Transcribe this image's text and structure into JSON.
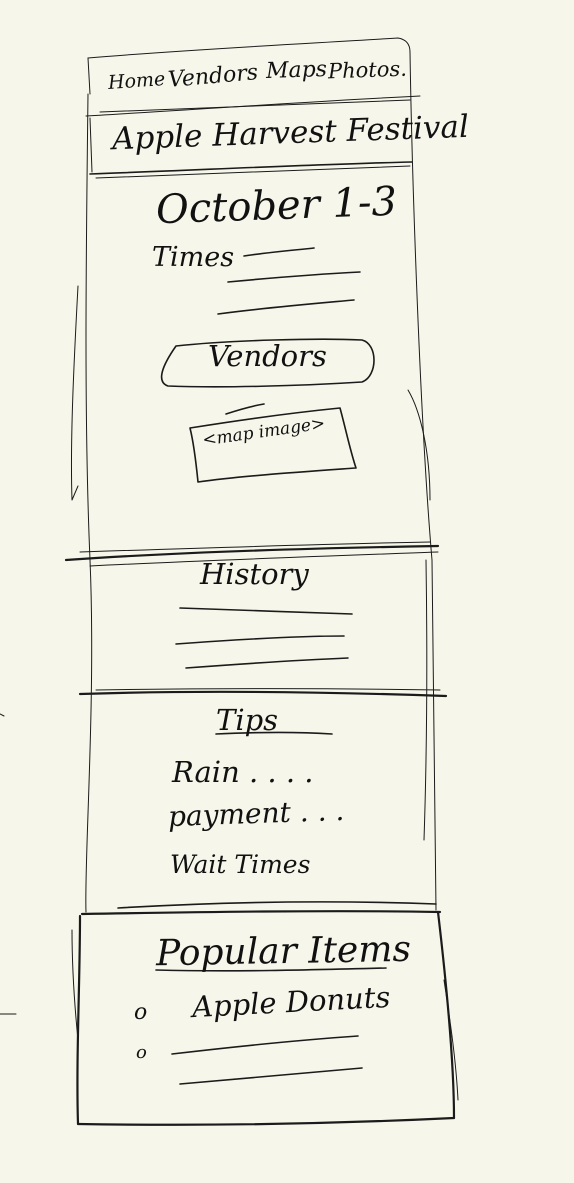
{
  "nav": {
    "home": "Home",
    "vendors": "Vendors",
    "maps": "Maps",
    "photos": "Photos."
  },
  "header": {
    "title": "Apple Harvest Festival"
  },
  "event": {
    "dates": "October 1-3",
    "times_label": "Times"
  },
  "vendors_button": {
    "label": "Vendors"
  },
  "map": {
    "placeholder": "<map image>"
  },
  "history": {
    "heading": "History"
  },
  "tips": {
    "heading": "Tips",
    "items": [
      "Rain . . . .",
      "payment . . .",
      "Wait Times"
    ]
  },
  "popular": {
    "heading": "Popular Items",
    "bullet": "o",
    "items": [
      "Apple Donuts"
    ]
  },
  "colors": {
    "paper": "#f6f6ea",
    "ink": "#1b1b1b"
  }
}
